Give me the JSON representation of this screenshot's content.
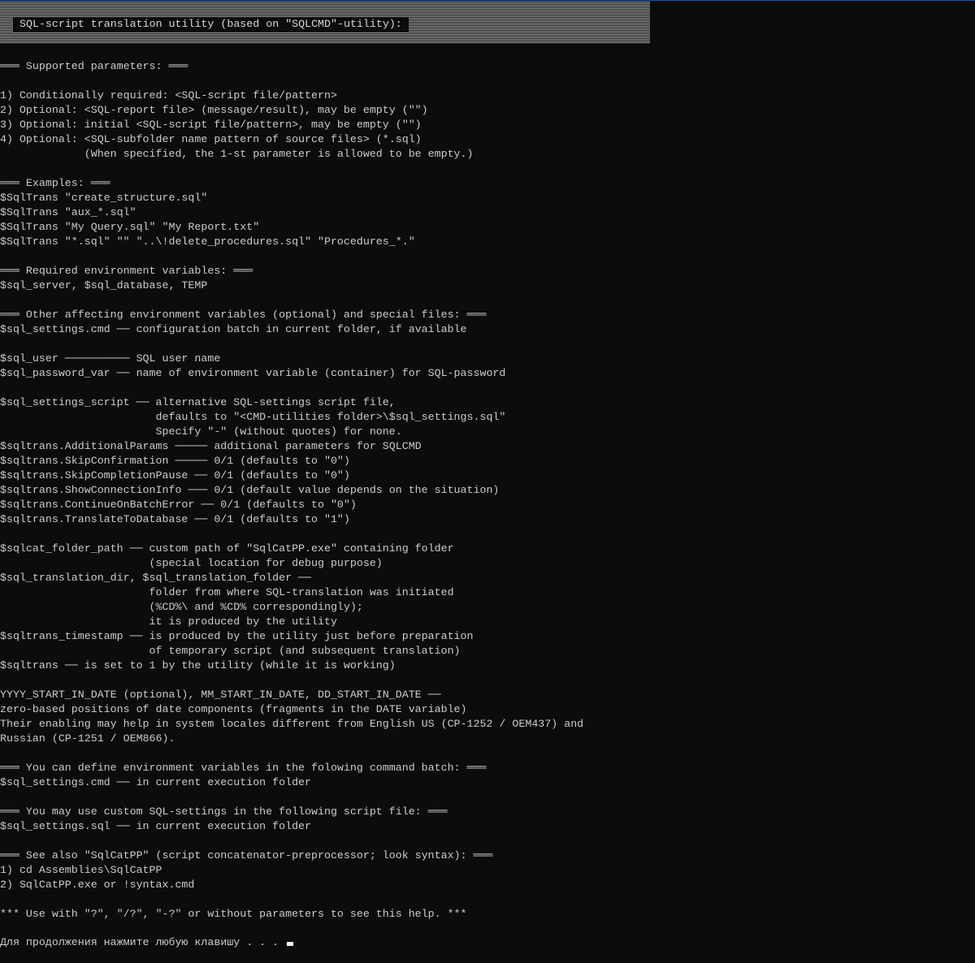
{
  "header": {
    "title": "SQL-script translation utility (based on \"SQLCMD\"-utility):"
  },
  "output_lines": [
    "═══ Supported parameters: ═══",
    "",
    "1) Conditionally required: <SQL-script file/pattern>",
    "2) Optional: <SQL-report file> (message/result), may be empty (\"\")",
    "3) Optional: initial <SQL-script file/pattern>, may be empty (\"\")",
    "4) Optional: <SQL-subfolder name pattern of source files> (*.sql)",
    "             (When specified, the 1-st parameter is allowed to be empty.)",
    "",
    "═══ Examples: ═══",
    "$SqlTrans \"create_structure.sql\"",
    "$SqlTrans \"aux_*.sql\"",
    "$SqlTrans \"My Query.sql\" \"My Report.txt\"",
    "$SqlTrans \"*.sql\" \"\" \"..\\!delete_procedures.sql\" \"Procedures_*.\"",
    "",
    "═══ Required environment variables: ═══",
    "$sql_server, $sql_database, TEMP",
    "",
    "═══ Other affecting environment variables (optional) and special files: ═══",
    "$sql_settings.cmd ── configuration batch in current folder, if available",
    "",
    "$sql_user ────────── SQL user name",
    "$sql_password_var ── name of environment variable (container) for SQL-password",
    "",
    "$sql_settings_script ── alternative SQL-settings script file,",
    "                        defaults to \"<CMD-utilities folder>\\$sql_settings.sql\"",
    "                        Specify \"-\" (without quotes) for none.",
    "$sqltrans.AdditionalParams ───── additional parameters for SQLCMD",
    "$sqltrans.SkipConfirmation ───── 0/1 (defaults to \"0\")",
    "$sqltrans.SkipCompletionPause ── 0/1 (defaults to \"0\")",
    "$sqltrans.ShowConnectionInfo ─── 0/1 (default value depends on the situation)",
    "$sqltrans.ContinueOnBatchError ── 0/1 (defaults to \"0\")",
    "$sqltrans.TranslateToDatabase ── 0/1 (defaults to \"1\")",
    "",
    "$sqlcat_folder_path ── custom path of \"SqlCatPP.exe\" containing folder",
    "                       (special location for debug purpose)",
    "$sql_translation_dir, $sql_translation_folder ──",
    "                       folder from where SQL-translation was initiated",
    "                       (%CD%\\ and %CD% correspondingly);",
    "                       it is produced by the utility",
    "$sqltrans_timestamp ── is produced by the utility just before preparation",
    "                       of temporary script (and subsequent translation)",
    "$sqltrans ── is set to 1 by the utility (while it is working)",
    "",
    "YYYY_START_IN_DATE (optional), MM_START_IN_DATE, DD_START_IN_DATE ──",
    "zero-based positions of date components (fragments in the DATE variable)",
    "Their enabling may help in system locales different from English US (CP-1252 / OEM437) and",
    "Russian (CP-1251 / OEM866).",
    "",
    "═══ You can define environment variables in the folowing command batch: ═══",
    "$sql_settings.cmd ── in current execution folder",
    "",
    "═══ You may use custom SQL-settings in the following script file: ═══",
    "$sql_settings.sql ── in current execution folder",
    "",
    "═══ See also \"SqlCatPP\" (script concatenator-preprocessor; look syntax): ═══",
    "1) cd Assemblies\\SqlCatPP",
    "2) SqlCatPP.exe or !syntax.cmd",
    "",
    "*** Use with \"?\", \"/?\", \"-?\" or without parameters to see this help. ***"
  ],
  "prompt": {
    "text": "Для продолжения нажмите любую клавишу . . . "
  },
  "colors": {
    "background": "#0c0c0c",
    "foreground": "#cccccc",
    "header_band": "#9a9a9a",
    "cursor": "#f2f2f2"
  }
}
